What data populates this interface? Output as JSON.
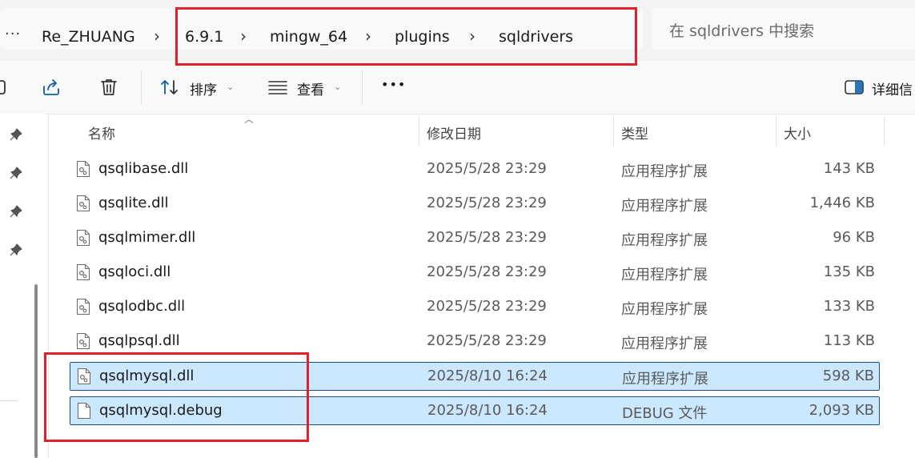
{
  "address_bar": {
    "overflow_icon": "more-dots-icon",
    "breadcrumbs": [
      "Re_ZHUANG",
      "6.9.1",
      "mingw_64",
      "plugins",
      "sqldrivers"
    ],
    "search_placeholder": "在 sqldrivers 中搜索"
  },
  "toolbar": {
    "sort_label": "排序",
    "view_label": "查看",
    "more_label": "•••",
    "details_label": "详细信"
  },
  "columns": {
    "name": "名称",
    "date": "修改日期",
    "type": "类型",
    "size": "大小"
  },
  "files": [
    {
      "name": "qsqlibase.dll",
      "date": "2025/5/28 23:29",
      "type": "应用程序扩展",
      "size": "143 KB",
      "icon": "dll-file-icon",
      "selected": false
    },
    {
      "name": "qsqlite.dll",
      "date": "2025/5/28 23:29",
      "type": "应用程序扩展",
      "size": "1,446 KB",
      "icon": "dll-file-icon",
      "selected": false
    },
    {
      "name": "qsqlmimer.dll",
      "date": "2025/5/28 23:29",
      "type": "应用程序扩展",
      "size": "96 KB",
      "icon": "dll-file-icon",
      "selected": false
    },
    {
      "name": "qsqloci.dll",
      "date": "2025/5/28 23:29",
      "type": "应用程序扩展",
      "size": "135 KB",
      "icon": "dll-file-icon",
      "selected": false
    },
    {
      "name": "qsqlodbc.dll",
      "date": "2025/5/28 23:29",
      "type": "应用程序扩展",
      "size": "133 KB",
      "icon": "dll-file-icon",
      "selected": false
    },
    {
      "name": "qsqlpsql.dll",
      "date": "2025/5/28 23:29",
      "type": "应用程序扩展",
      "size": "113 KB",
      "icon": "dll-file-icon",
      "selected": false
    },
    {
      "name": "qsqlmysql.dll",
      "date": "2025/8/10 16:24",
      "type": "应用程序扩展",
      "size": "598 KB",
      "icon": "dll-file-icon",
      "selected": true
    },
    {
      "name": "qsqlmysql.debug",
      "date": "2025/8/10 16:24",
      "type": "DEBUG 文件",
      "size": "2,093 KB",
      "icon": "blank-file-icon",
      "selected": true
    }
  ],
  "colors": {
    "highlight_border": "#e0202a",
    "selection_fill": "#cce8ff",
    "selection_border": "#1a4f85"
  }
}
